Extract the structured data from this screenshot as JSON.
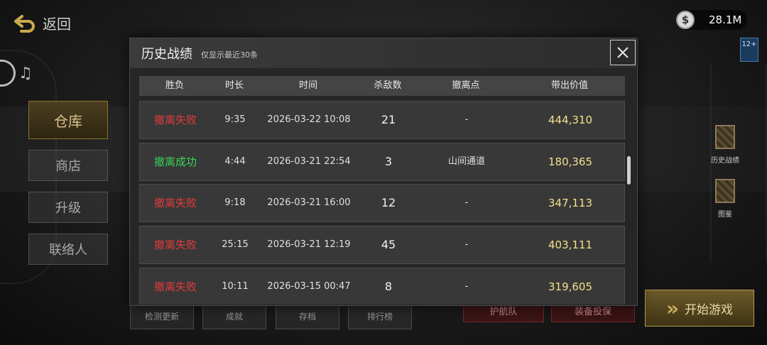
{
  "nav": {
    "back_label": "返回"
  },
  "currency": {
    "amount": "28.1M",
    "icon": "dollar-coin-icon"
  },
  "age_rating": {
    "label": "12+"
  },
  "left_menu": [
    {
      "label": "仓库",
      "active": true
    },
    {
      "label": "商店"
    },
    {
      "label": "升级"
    },
    {
      "label": "联络人"
    }
  ],
  "right_menu": [
    {
      "label": "历史战绩"
    },
    {
      "label": "图鉴"
    }
  ],
  "bottom_buttons": [
    "检测更新",
    "成就",
    "存档",
    "排行榜"
  ],
  "bottom_red_buttons": [
    "护航队",
    "装备投保"
  ],
  "start_button": {
    "label": "开始游戏"
  },
  "modal": {
    "title": "历史战绩",
    "subtitle": "仅显示最近30条",
    "columns": [
      "胜负",
      "时长",
      "时间",
      "杀敌数",
      "撤离点",
      "带出价值"
    ],
    "rows": [
      {
        "result": "撤离失败",
        "status": "fail",
        "duration": "9:35",
        "time": "2026-03-22 10:08",
        "kills": "21",
        "exit_point": "-",
        "value": "444,310"
      },
      {
        "result": "撤离成功",
        "status": "win",
        "duration": "4:44",
        "time": "2026-03-21 22:54",
        "kills": "3",
        "exit_point": "山间通道",
        "value": "180,365"
      },
      {
        "result": "撤离失败",
        "status": "fail",
        "duration": "9:18",
        "time": "2026-03-21 16:00",
        "kills": "12",
        "exit_point": "-",
        "value": "347,113"
      },
      {
        "result": "撤离失败",
        "status": "fail",
        "duration": "25:15",
        "time": "2026-03-21 12:19",
        "kills": "45",
        "exit_point": "-",
        "value": "403,111"
      },
      {
        "result": "撤离失败",
        "status": "fail",
        "duration": "10:11",
        "time": "2026-03-15 00:47",
        "kills": "8",
        "exit_point": "-",
        "value": "319,605"
      }
    ]
  },
  "colors": {
    "fail": "#e23b3b",
    "win": "#39d45a",
    "value": "#f3e08a"
  }
}
